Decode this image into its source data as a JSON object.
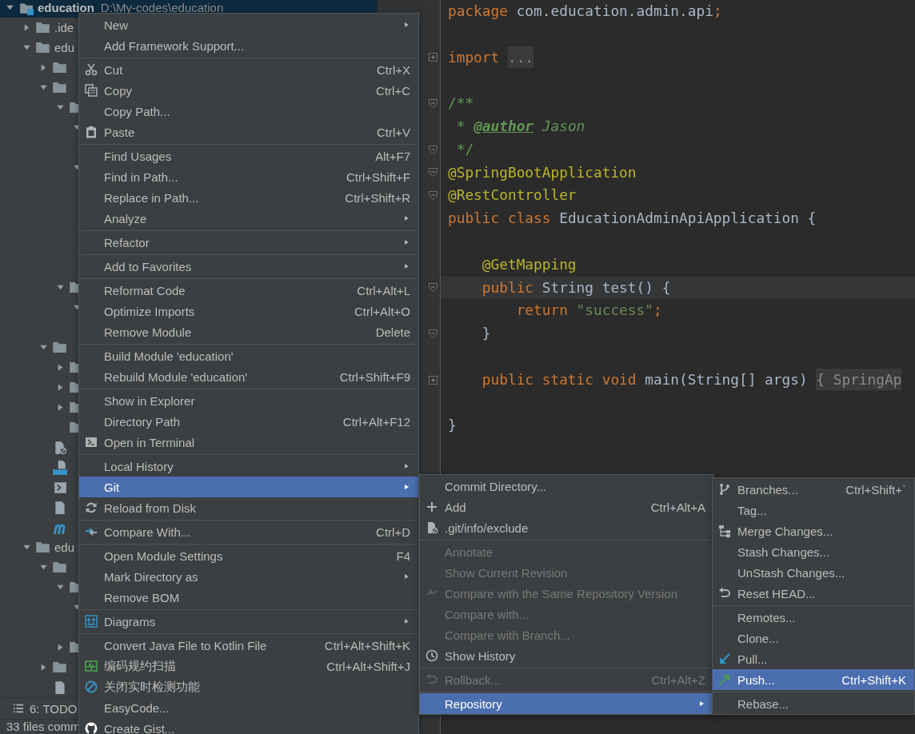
{
  "project_tree": [
    {
      "kind": "module",
      "label": "education",
      "path": "D:\\My-codes\\education",
      "expanded": true,
      "selected": true,
      "children": [
        {
          "kind": "folder",
          "label": ".ide",
          "expanded": false,
          "selected": false
        },
        {
          "kind": "folder",
          "label": "edu",
          "expanded": true,
          "selected": false,
          "children": [
            {
              "kind": "folder",
              "expanded": false,
              "selected": false
            },
            {
              "kind": "folder",
              "expanded": true,
              "selected": false,
              "children": [
                {
                  "kind": "folder",
                  "expanded": true,
                  "selected": false,
                  "children": [
                    {
                      "expanded": true,
                      "selected": false,
                      "children": [
                        {
                          "selected": false
                        }
                      ]
                    },
                    {
                      "expanded": true,
                      "selected": false,
                      "children": [
                        {
                          "selected": false
                        },
                        {
                          "selected": false
                        },
                        {
                          "selected": false
                        },
                        {
                          "selected": false
                        },
                        {
                          "selected": false
                        }
                      ]
                    }
                  ]
                },
                {
                  "kind": "folder",
                  "expanded": true,
                  "selected": false,
                  "children": [
                    {
                      "expanded": true,
                      "selected": false,
                      "children": [
                        {
                          "selected": false
                        }
                      ]
                    }
                  ]
                }
              ]
            },
            {
              "kind": "folder",
              "expanded": true,
              "selected": false,
              "children": [
                {
                  "kind": "folder",
                  "expanded": false,
                  "selected": false
                },
                {
                  "kind": "folder",
                  "expanded": false,
                  "selected": false
                },
                {
                  "kind": "folder",
                  "expanded": false,
                  "selected": false
                },
                {
                  "kind": "folder",
                  "selected": false
                }
              ]
            },
            {
              "kind": "excluded-file",
              "selected": false
            },
            {
              "kind": "markdown",
              "selected": false
            },
            {
              "kind": "script",
              "selected": false
            },
            {
              "kind": "file",
              "selected": false
            },
            {
              "kind": "maven",
              "selected": false
            }
          ]
        },
        {
          "kind": "folder",
          "label": "edu",
          "expanded": true,
          "selected": false,
          "children": [
            {
              "kind": "folder",
              "expanded": true,
              "selected": false,
              "children": [
                {
                  "kind": "folder",
                  "expanded": true,
                  "selected": false,
                  "children": [
                    {
                      "expanded": true,
                      "selected": false,
                      "children": [
                        {
                          "selected": false
                        }
                      ]
                    }
                  ]
                },
                {
                  "kind": "folder",
                  "expanded": false,
                  "selected": false
                }
              ]
            },
            {
              "kind": "folder",
              "expanded": false,
              "selected": false
            },
            {
              "kind": "file",
              "selected": false
            }
          ]
        }
      ]
    }
  ],
  "tool_bar": {
    "label": "6: TODO"
  },
  "status_bar": {
    "text": "33 files comm"
  },
  "editor": {
    "lines": [
      {
        "current": false,
        "tokens": [
          {
            "kind": "keyword",
            "text": "package "
          },
          {
            "kind": "plain",
            "text": "com.education.admin.api"
          },
          {
            "kind": "keyword",
            "text": ";"
          }
        ]
      },
      {
        "current": false
      },
      {
        "current": false,
        "folded": true,
        "tokens": [
          {
            "kind": "keyword",
            "text": "import "
          },
          {
            "kind": "folded",
            "text": "..."
          }
        ]
      },
      {
        "current": false
      },
      {
        "current": false,
        "folded": false,
        "tokens": [
          {
            "kind": "doc",
            "text": "/**"
          }
        ]
      },
      {
        "current": false,
        "tokens": [
          {
            "kind": "doc",
            "text": " * "
          },
          {
            "kind": "doctag",
            "text": "@author"
          },
          {
            "kind": "docvalue",
            "text": " Jason"
          }
        ]
      },
      {
        "current": false,
        "folded": false,
        "tokens": [
          {
            "kind": "doc",
            "text": " */"
          }
        ]
      },
      {
        "current": false,
        "folded": false,
        "tokens": [
          {
            "kind": "annotation",
            "text": "@SpringBootApplication"
          }
        ]
      },
      {
        "current": false,
        "folded": false,
        "tokens": [
          {
            "kind": "annotation",
            "text": "@RestController"
          }
        ]
      },
      {
        "current": false,
        "tokens": [
          {
            "kind": "keyword",
            "text": "public class "
          },
          {
            "kind": "plain",
            "text": "EducationAdminApiApplication {"
          }
        ]
      },
      {
        "current": false
      },
      {
        "current": false,
        "tokens": [
          {
            "kind": "annotation",
            "text": "    @GetMapping"
          }
        ]
      },
      {
        "current": true,
        "folded": false,
        "tokens": [
          {
            "kind": "keyword",
            "text": "    public "
          },
          {
            "kind": "plain",
            "text": "String test() {"
          }
        ]
      },
      {
        "current": false,
        "tokens": [
          {
            "kind": "keyword",
            "text": "        return "
          },
          {
            "kind": "string",
            "text": "\"success\""
          },
          {
            "kind": "keyword",
            "text": ";"
          }
        ]
      },
      {
        "current": false,
        "folded": false,
        "tokens": [
          {
            "kind": "plain",
            "text": "    }"
          }
        ]
      },
      {
        "current": false
      },
      {
        "current": false,
        "folded": true,
        "tokens": [
          {
            "kind": "keyword",
            "text": "    public static void "
          },
          {
            "kind": "plain",
            "text": "main(String[] args) "
          },
          {
            "kind": "folded",
            "text": "{ SpringAp"
          }
        ]
      },
      {
        "current": false
      },
      {
        "current": false,
        "tokens": [
          {
            "kind": "plain",
            "text": "}"
          }
        ]
      }
    ]
  },
  "context_menu": {
    "items": [
      {
        "kind": "item",
        "label": "New",
        "submenu": true,
        "selected": false
      },
      {
        "kind": "item",
        "label": "Add Framework Support...",
        "selected": false
      },
      {
        "kind": "separator"
      },
      {
        "kind": "item",
        "label": "Cut",
        "shortcut": "Ctrl+X",
        "selected": false
      },
      {
        "kind": "item",
        "label": "Copy",
        "shortcut": "Ctrl+C",
        "selected": false
      },
      {
        "kind": "item",
        "label": "Copy Path...",
        "selected": false
      },
      {
        "kind": "item",
        "label": "Paste",
        "shortcut": "Ctrl+V",
        "selected": false
      },
      {
        "kind": "separator"
      },
      {
        "kind": "item",
        "label": "Find Usages",
        "shortcut": "Alt+F7",
        "selected": false
      },
      {
        "kind": "item",
        "label": "Find in Path...",
        "shortcut": "Ctrl+Shift+F",
        "selected": false
      },
      {
        "kind": "item",
        "label": "Replace in Path...",
        "shortcut": "Ctrl+Shift+R",
        "selected": false
      },
      {
        "kind": "item",
        "label": "Analyze",
        "submenu": true,
        "selected": false
      },
      {
        "kind": "separator"
      },
      {
        "kind": "item",
        "label": "Refactor",
        "submenu": true,
        "selected": false
      },
      {
        "kind": "separator"
      },
      {
        "kind": "item",
        "label": "Add to Favorites",
        "submenu": true,
        "selected": false
      },
      {
        "kind": "separator"
      },
      {
        "kind": "item",
        "label": "Reformat Code",
        "shortcut": "Ctrl+Alt+L",
        "selected": false
      },
      {
        "kind": "item",
        "label": "Optimize Imports",
        "shortcut": "Ctrl+Alt+O",
        "selected": false
      },
      {
        "kind": "item",
        "label": "Remove Module",
        "shortcut": "Delete",
        "selected": false
      },
      {
        "kind": "separator"
      },
      {
        "kind": "item",
        "label": "Build Module 'education'",
        "selected": false
      },
      {
        "kind": "item",
        "label": "Rebuild Module 'education'",
        "shortcut": "Ctrl+Shift+F9",
        "selected": false
      },
      {
        "kind": "separator"
      },
      {
        "kind": "item",
        "label": "Show in Explorer",
        "selected": false
      },
      {
        "kind": "item",
        "label": "Directory Path",
        "shortcut": "Ctrl+Alt+F12",
        "selected": false
      },
      {
        "kind": "item",
        "label": "Open in Terminal",
        "selected": false
      },
      {
        "kind": "separator"
      },
      {
        "kind": "item",
        "label": "Local History",
        "submenu": true,
        "selected": false
      },
      {
        "kind": "item",
        "label": "Git",
        "submenu": true,
        "selected": true
      },
      {
        "kind": "item",
        "label": "Reload from Disk",
        "selected": false
      },
      {
        "kind": "separator"
      },
      {
        "kind": "item",
        "label": "Compare With...",
        "shortcut": "Ctrl+D",
        "selected": false
      },
      {
        "kind": "separator"
      },
      {
        "kind": "item",
        "label": "Open Module Settings",
        "shortcut": "F4",
        "selected": false
      },
      {
        "kind": "item",
        "label": "Mark Directory as",
        "submenu": true,
        "selected": false
      },
      {
        "kind": "item",
        "label": "Remove BOM",
        "selected": false
      },
      {
        "kind": "separator"
      },
      {
        "kind": "item",
        "label": "Diagrams",
        "submenu": true,
        "selected": false
      },
      {
        "kind": "separator"
      },
      {
        "kind": "item",
        "label": "Convert Java File to Kotlin File",
        "shortcut": "Ctrl+Alt+Shift+K",
        "selected": false
      },
      {
        "kind": "item",
        "label": "编码规约扫描",
        "shortcut": "Ctrl+Alt+Shift+J",
        "selected": false
      },
      {
        "kind": "item",
        "label": "关闭实时检测功能",
        "selected": false
      },
      {
        "kind": "item",
        "label": "EasyCode...",
        "selected": false
      },
      {
        "kind": "item",
        "label": "Create Gist...",
        "selected": false
      }
    ]
  },
  "git_submenu": {
    "items": [
      {
        "kind": "item",
        "label": "Commit Directory...",
        "disabled": false,
        "selected": false
      },
      {
        "kind": "item",
        "label": "Add",
        "shortcut": "Ctrl+Alt+A",
        "disabled": false,
        "selected": false
      },
      {
        "kind": "item",
        "label": ".git/info/exclude",
        "disabled": false,
        "selected": false
      },
      {
        "kind": "separator"
      },
      {
        "kind": "item",
        "label": "Annotate",
        "disabled": true,
        "selected": false
      },
      {
        "kind": "item",
        "label": "Show Current Revision",
        "disabled": true,
        "selected": false
      },
      {
        "kind": "item",
        "label": "Compare with the Same Repository Version",
        "disabled": true,
        "selected": false
      },
      {
        "kind": "item",
        "label": "Compare with...",
        "disabled": true,
        "selected": false
      },
      {
        "kind": "item",
        "label": "Compare with Branch...",
        "disabled": true,
        "selected": false
      },
      {
        "kind": "item",
        "label": "Show History",
        "disabled": false,
        "selected": false
      },
      {
        "kind": "separator"
      },
      {
        "kind": "item",
        "label": "Rollback...",
        "shortcut": "Ctrl+Alt+Z",
        "disabled": true,
        "selected": false
      },
      {
        "kind": "separator"
      },
      {
        "kind": "item",
        "label": "Repository",
        "submenu": true,
        "disabled": false,
        "selected": true
      }
    ]
  },
  "repository_submenu": {
    "items": [
      {
        "kind": "item",
        "label": "Branches...",
        "shortcut": "Ctrl+Shift+`",
        "selected": false
      },
      {
        "kind": "item",
        "label": "Tag...",
        "selected": false
      },
      {
        "kind": "item",
        "label": "Merge Changes...",
        "selected": false
      },
      {
        "kind": "item",
        "label": "Stash Changes...",
        "selected": false
      },
      {
        "kind": "item",
        "label": "UnStash Changes...",
        "selected": false
      },
      {
        "kind": "item",
        "label": "Reset HEAD...",
        "selected": false
      },
      {
        "kind": "separator"
      },
      {
        "kind": "item",
        "label": "Remotes...",
        "selected": false
      },
      {
        "kind": "item",
        "label": "Clone...",
        "selected": false
      },
      {
        "kind": "item",
        "label": "Pull...",
        "selected": false
      },
      {
        "kind": "item",
        "label": "Push...",
        "shortcut": "Ctrl+Shift+K",
        "selected": true
      },
      {
        "kind": "separator"
      },
      {
        "kind": "item",
        "label": "Rebase...",
        "selected": false
      }
    ]
  }
}
